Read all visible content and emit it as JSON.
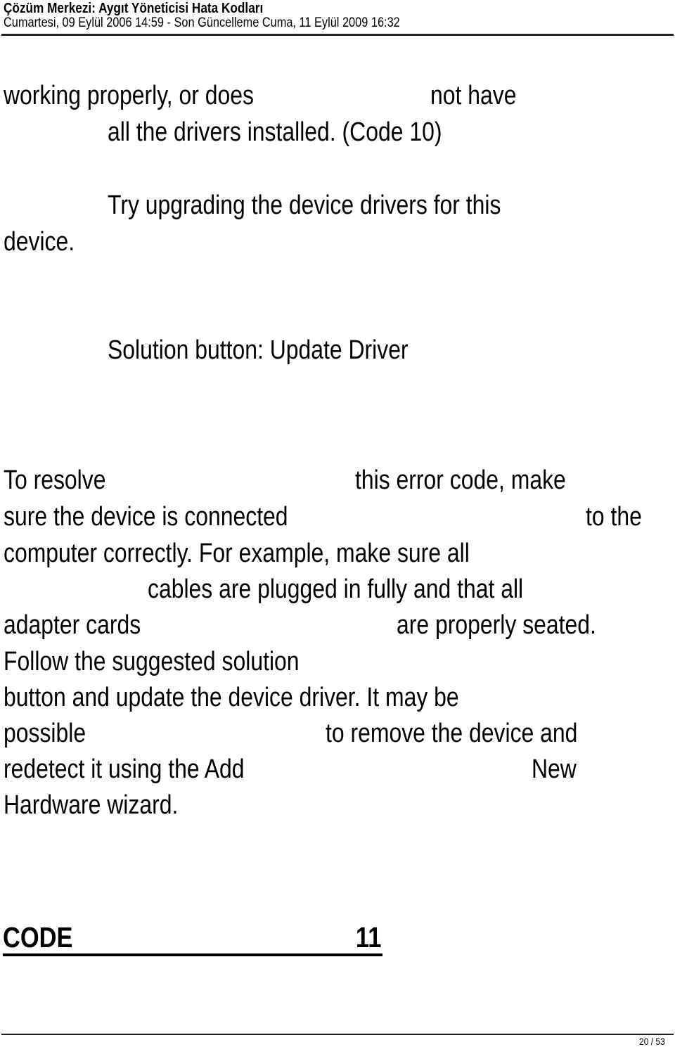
{
  "header": {
    "title": "Çözüm Merkezi: Aygıt Yöneticisi Hata Kodları",
    "subtitle": "Cumartesi, 09 Eylül 2006 14:59 - Son Güncelleme Cuma, 11 Eylül 2009 16:32"
  },
  "body": {
    "lines": [
      "working properly, or does",
      "not have",
      "all the drivers installed. (Code 10)",
      "Try upgrading the device drivers for this",
      "device.",
      "Solution button: Update Driver",
      "To resolve",
      "this error code, make",
      "sure the device is connected",
      "to the",
      "computer correctly. For example, make sure all",
      "cables are plugged in fully and that all",
      "adapter cards",
      "are properly seated.",
      "Follow the suggested solution",
      "button and update the device driver. It may be",
      "possible",
      "to remove the device and",
      "redetect it using the Add",
      "New",
      "Hardware wizard."
    ]
  },
  "section": {
    "code_label": "CODE",
    "code_number": "11"
  },
  "footer": {
    "page_indicator": "20 / 53"
  }
}
